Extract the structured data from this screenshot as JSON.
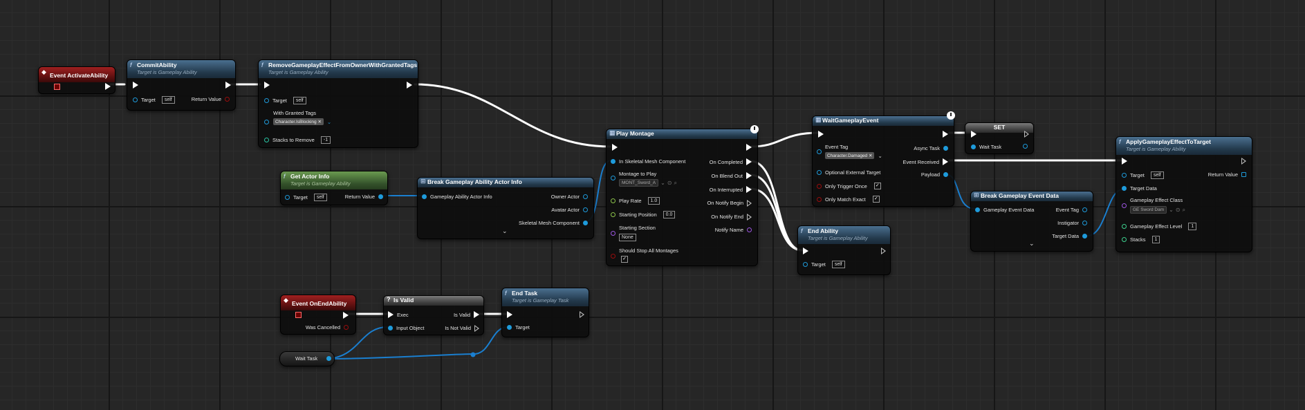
{
  "nodes": {
    "event_activate": {
      "title": "Event ActivateAbility"
    },
    "commit": {
      "title": "CommitAbility",
      "subtitle": "Target is Gameplay Ability",
      "target_label": "Target",
      "target_value": "self",
      "return_label": "Return Value"
    },
    "remove_ge": {
      "title": "RemoveGameplayEffectFromOwnerWithGrantedTags",
      "subtitle": "Target is Gameplay Ability",
      "target_label": "Target",
      "target_value": "self",
      "tags_label": "With Granted Tags",
      "tags_value": "Character.IsBlocking",
      "stacks_label": "Stacks to Remove",
      "stacks_value": "-1"
    },
    "get_actor_info": {
      "title": "Get Actor Info",
      "subtitle": "Target is Gameplay Ability",
      "target_label": "Target",
      "target_value": "self",
      "return_label": "Return Value"
    },
    "break_actor_info": {
      "title": "Break Gameplay Ability Actor Info",
      "input_label": "Gameplay Ability Actor Info",
      "owner": "Owner Actor",
      "avatar": "Avatar Actor",
      "skeletal": "Skeletal Mesh Component"
    },
    "play_montage": {
      "title": "Play Montage",
      "in_skel": "In Skeletal Mesh Component",
      "montage_label": "Montage to Play",
      "montage_value": "MONT_Sword_A",
      "play_rate_label": "Play Rate",
      "play_rate_value": "1.0",
      "start_pos_label": "Starting Position",
      "start_pos_value": "0.0",
      "start_section_label": "Starting Section",
      "start_section_value": "None",
      "stop_all_label": "Should Stop All Montages",
      "on_completed": "On Completed",
      "on_blend_out": "On Blend Out",
      "on_interrupted": "On Interrupted",
      "on_notify_begin": "On Notify Begin",
      "on_notify_end": "On Notify End",
      "notify_name": "Notify Name"
    },
    "wait_event": {
      "title": "WaitGameplayEvent",
      "event_tag_label": "Event Tag",
      "event_tag_value": "Character.Damaged",
      "optional_label": "Optional External Target",
      "only_trigger_label": "Only Trigger Once",
      "only_match_label": "Only Match Exact",
      "async_task": "Async Task",
      "event_received": "Event Received",
      "payload": "Payload"
    },
    "set": {
      "title": "SET",
      "wait_task": "Wait Task"
    },
    "break_event_data": {
      "title": "Break Gameplay Event Data",
      "input_label": "Gameplay Event Data",
      "event_tag": "Event Tag",
      "instigator": "Instigator",
      "target_data": "Target Data"
    },
    "apply_ge": {
      "title": "ApplyGameplayEffectToTarget",
      "subtitle": "Target is Gameplay Ability",
      "target_label": "Target",
      "target_value": "self",
      "return_label": "Return Value",
      "target_data": "Target Data",
      "ge_class_label": "Gameplay Effect Class",
      "ge_class_value": "GE Sword Dam",
      "ge_level_label": "Gameplay Effect Level",
      "ge_level_value": "1",
      "stacks_label": "Stacks",
      "stacks_value": "1"
    },
    "end_ability": {
      "title": "End Ability",
      "subtitle": "Target is Gameplay Ability",
      "target_label": "Target",
      "target_value": "self"
    },
    "event_end": {
      "title": "Event OnEndAbility",
      "was_cancelled": "Was Cancelled"
    },
    "is_valid": {
      "title": "Is Valid",
      "exec": "Exec",
      "input_object": "Input Object",
      "is_valid": "Is Valid",
      "is_not_valid": "Is Not Valid"
    },
    "end_task": {
      "title": "End Task",
      "subtitle": "Target is Gameplay Task",
      "target_label": "Target"
    },
    "wait_task_var": {
      "title": "Wait Task"
    }
  },
  "colors": {
    "exec": "#ffffff",
    "object": "#1e9bdb",
    "bool": "#9a0d0d",
    "float": "#8bc24a",
    "struct": "#1e9bdb",
    "name": "#9b55e0",
    "function_header": "#35556f",
    "event_header": "#7a1515",
    "pure_header": "#4f7a3e"
  },
  "icons": {
    "function": "f-icon",
    "event": "event-icon",
    "latent": "clock-icon",
    "macro": "question-icon",
    "struct": "struct-icon"
  }
}
